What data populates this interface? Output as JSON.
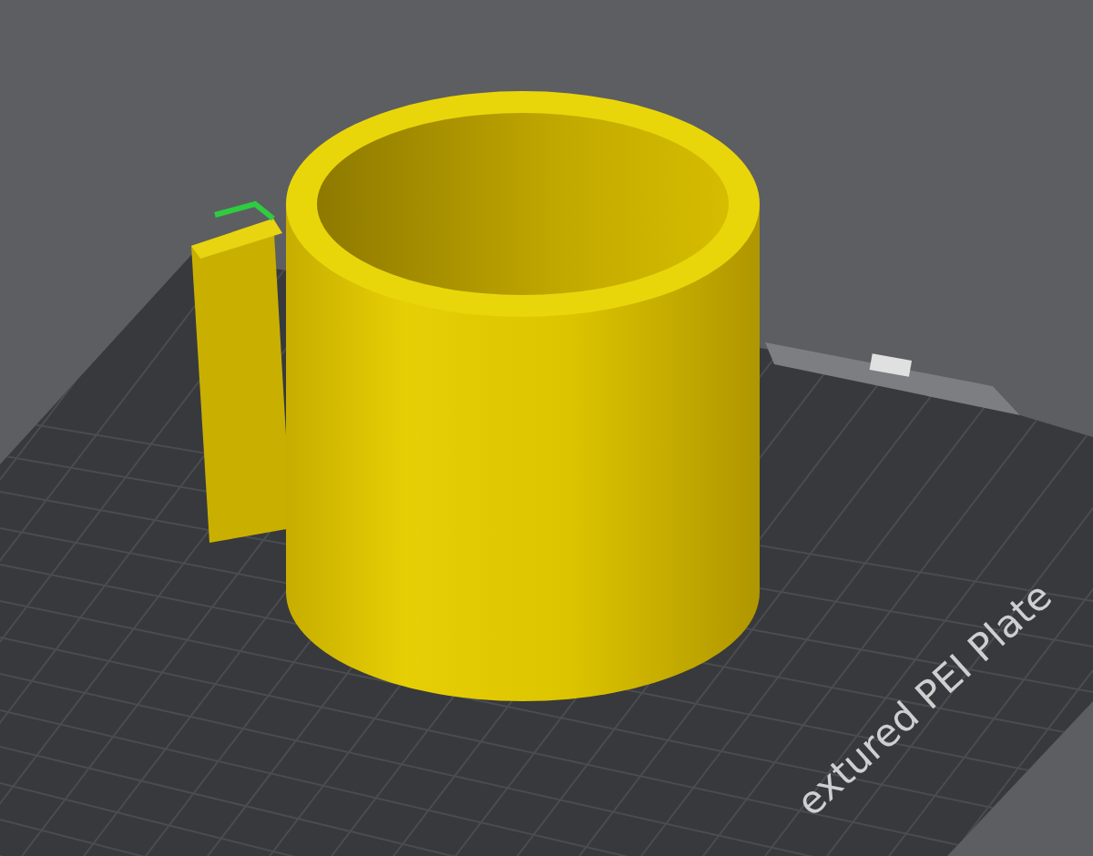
{
  "viewport": {
    "plate_label": "extured PEI Plate"
  }
}
